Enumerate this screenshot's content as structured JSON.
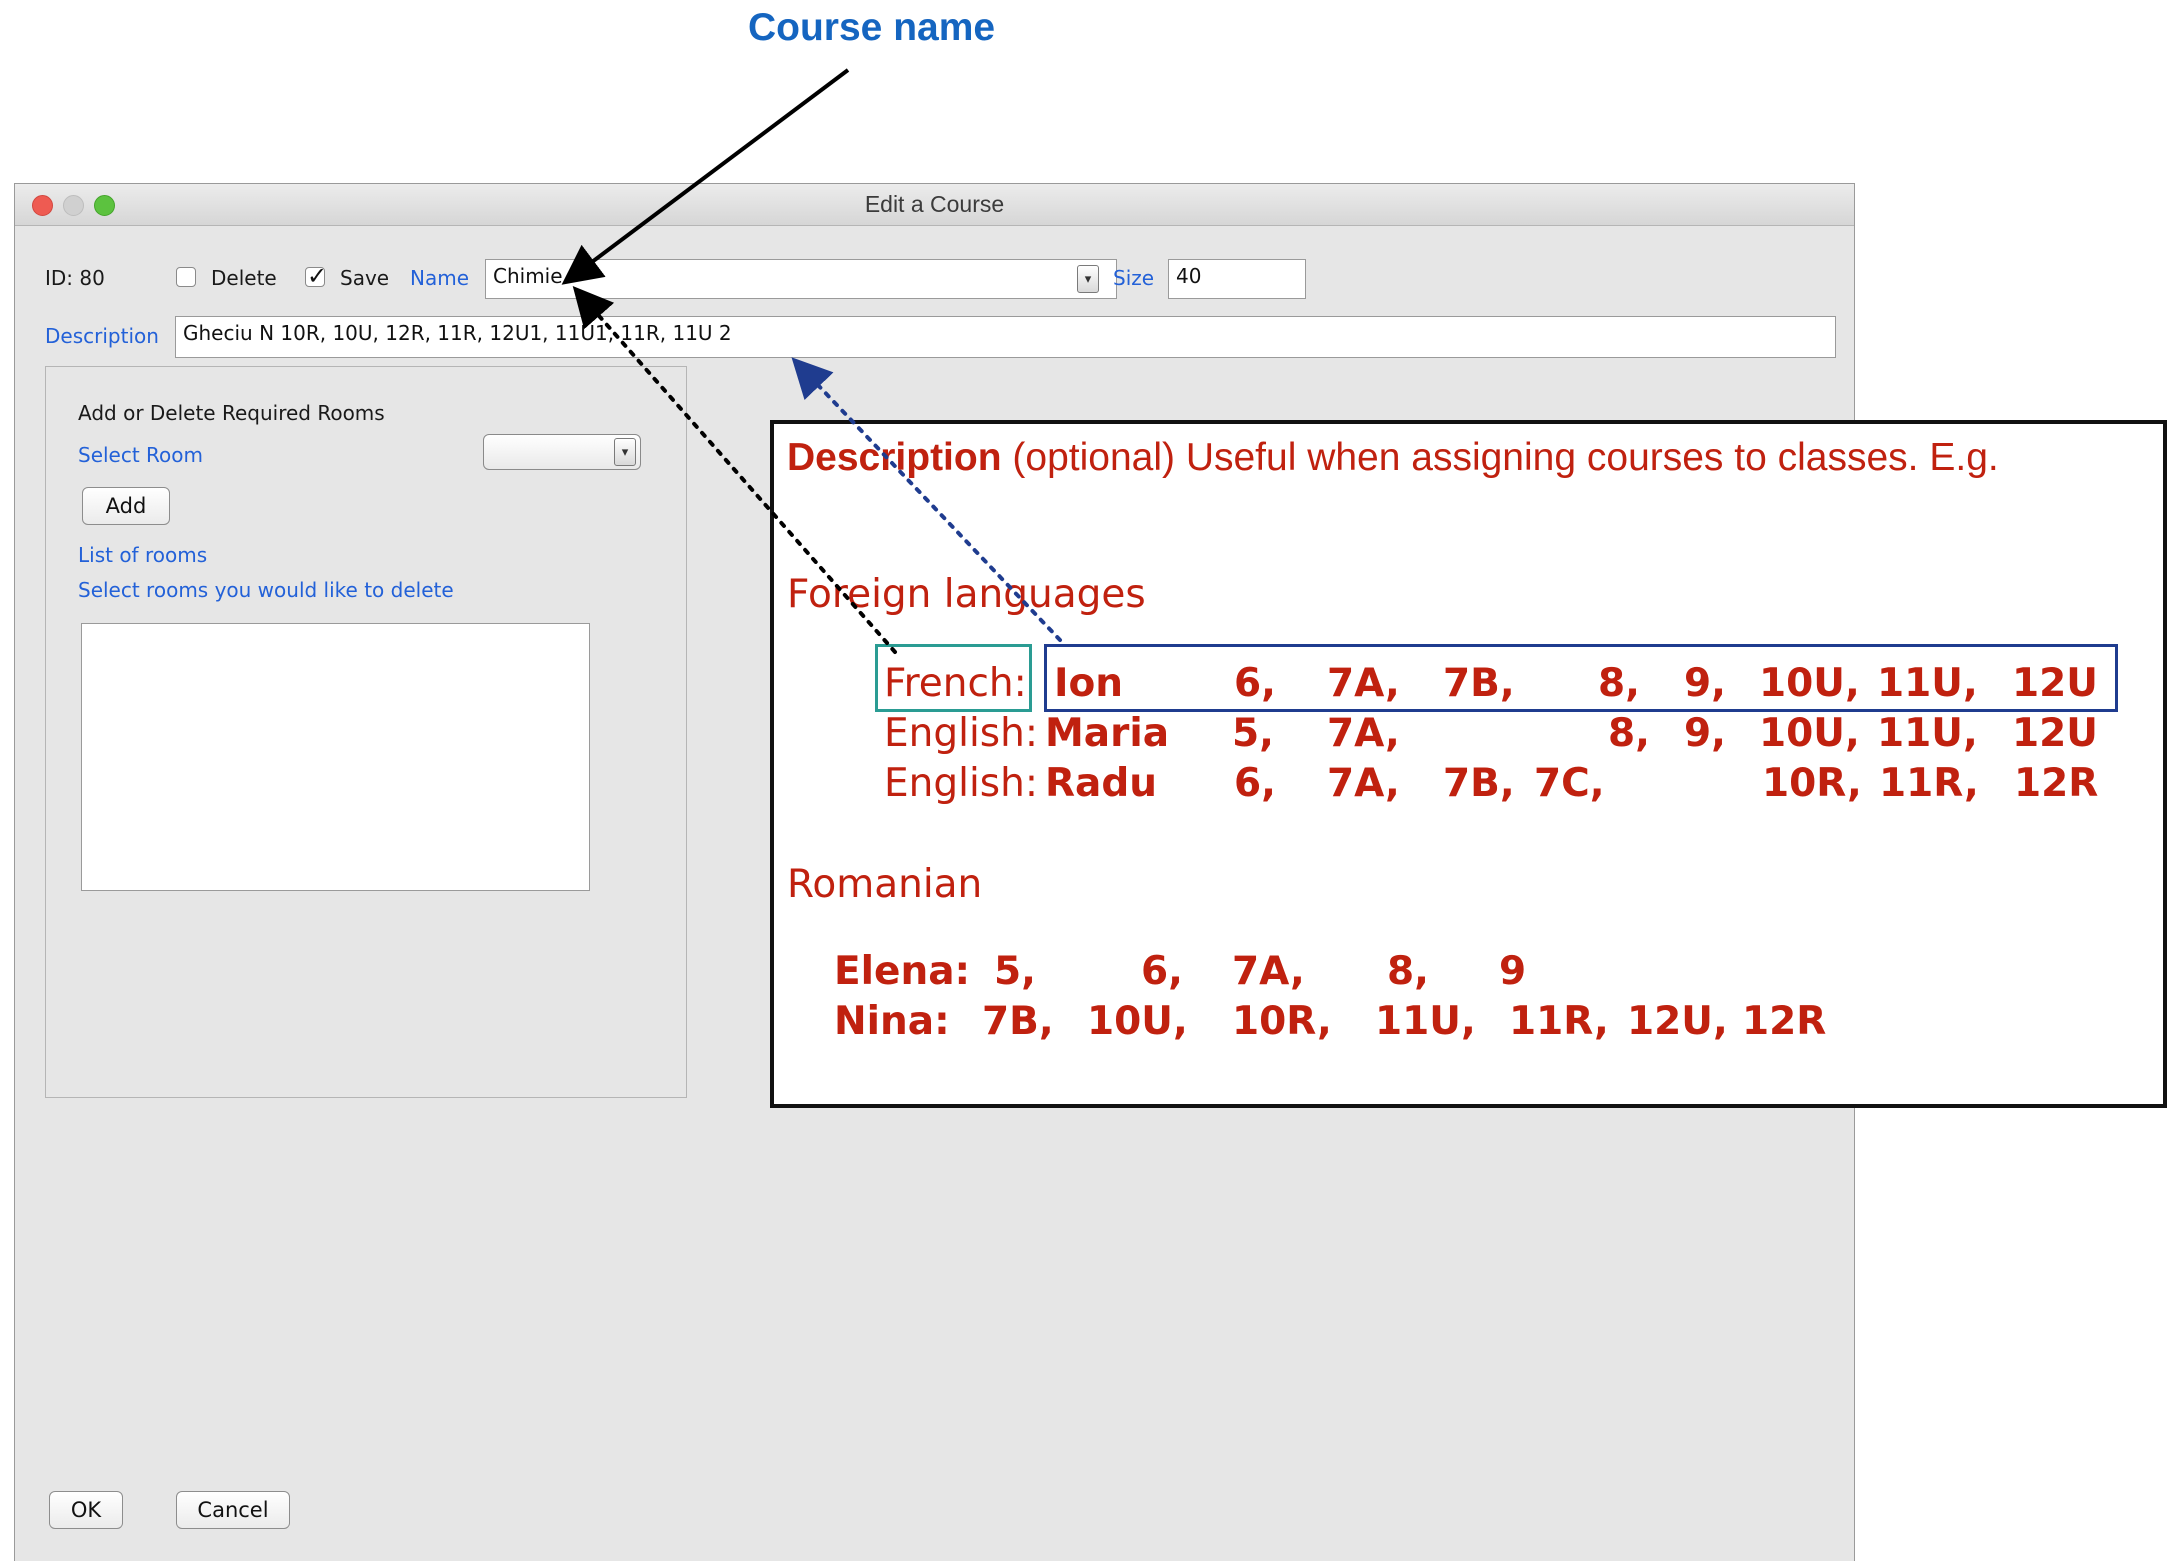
{
  "annotation": {
    "title": "Course name"
  },
  "window": {
    "title": "Edit a Course",
    "id_label": "ID: 80",
    "delete_label": "Delete",
    "delete_checked": false,
    "save_label": "Save",
    "save_checked": true,
    "name_label": "Name",
    "name_value": "Chimie",
    "size_label": "Size",
    "size_value": "40",
    "description_label": "Description",
    "description_value": "Gheciu N 10R, 10U, 12R, 11R, 12U1, 11U1, 11R, 11U 2",
    "rooms_panel": {
      "heading": "Add or Delete Required Rooms",
      "select_room_label": "Select Room",
      "add_button": "Add",
      "list_label": "List of rooms",
      "delete_hint": "Select rooms you would like to delete"
    },
    "ok_button": "OK",
    "cancel_button": "Cancel"
  },
  "description_box": {
    "title_bold": "Description",
    "title_rest": "(optional) Useful when assigning courses to classes. E.g.",
    "foreign_heading": "Foreign languages",
    "foreign_rows": [
      {
        "label": "French:",
        "teacher": "Ion",
        "classes": [
          "6,",
          "7A,",
          "7B,",
          "8,",
          "9,",
          "10U,",
          "11U,",
          "12U"
        ]
      },
      {
        "label": "English:",
        "teacher": "Maria",
        "classes": [
          "5,",
          "7A,",
          "8,",
          "9,",
          "10U,",
          "11U,",
          "12U"
        ]
      },
      {
        "label": "English:",
        "teacher": "Radu",
        "classes": [
          "6,",
          "7A,",
          "7B,",
          "7C,",
          "10R,",
          "11R,",
          "12R"
        ]
      }
    ],
    "romanian_heading": "Romanian",
    "romanian_rows": [
      {
        "teacher": "Elena:",
        "classes": [
          "5,",
          "6,",
          "7A,",
          "8,",
          "9"
        ]
      },
      {
        "teacher": "Nina:",
        "classes": [
          "7B,",
          "10U,",
          "10R,",
          "11U,",
          "11R,",
          "12U,",
          "12R"
        ]
      }
    ]
  },
  "colors": {
    "accent_blue": "#2361d8",
    "annotation_red": "#c0210f",
    "teal_box": "#2a9c93",
    "navy_box": "#1f3c8f"
  }
}
